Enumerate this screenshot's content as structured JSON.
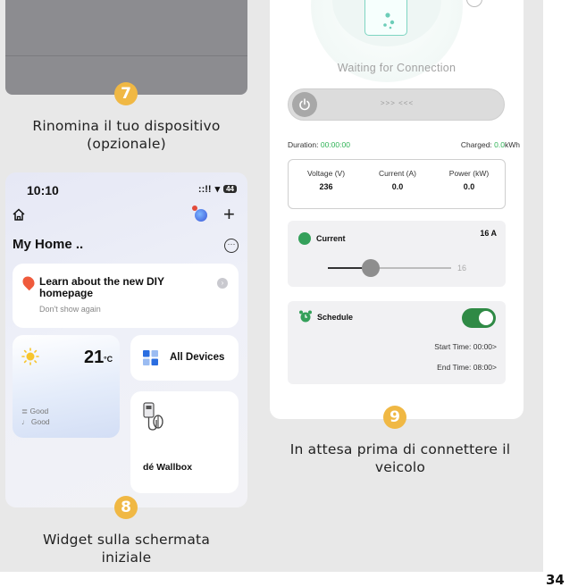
{
  "steps": {
    "step7": {
      "number": "7",
      "caption": "Rinomina il tuo dispositivo (opzionale)"
    },
    "step8": {
      "number": "8",
      "caption": "Widget sulla schermata iniziale"
    },
    "step9": {
      "number": "9",
      "caption": "In attesa prima di connettere il veicolo"
    }
  },
  "home_screen": {
    "status_time": "10:10",
    "status_signal": "::!! ",
    "status_wifi": "▾",
    "battery": "44",
    "title": "My Home ..",
    "learn_card": {
      "title": "Learn about the new DIY homepage",
      "dismiss": "Don't show again",
      "arrow": "›"
    },
    "weather": {
      "temperature": "21",
      "unit": "°C",
      "line1": "≣ Good",
      "line2": "♩ Good"
    },
    "all_devices_label": "All Devices",
    "wallbox_label": "dé Wallbox"
  },
  "charger_screen": {
    "status": "Waiting for Connection",
    "slide_hint": ">>> <<<",
    "duration_label": "Duration: ",
    "duration_value": "00:00:00",
    "charged_label": "Charged: ",
    "charged_value": "0.0",
    "charged_unit": "kWh",
    "metrics": [
      {
        "label": "Voltage (V)",
        "value": "236"
      },
      {
        "label": "Current (A)",
        "value": "0.0"
      },
      {
        "label": "Power (kW)",
        "value": "0.0"
      }
    ],
    "current": {
      "title": "Current",
      "value": "16 A",
      "slider_max": "16",
      "slider_level": 0.35
    },
    "schedule": {
      "title": "Schedule",
      "enabled": true,
      "start_time": "Start Time: 00:00>",
      "end_time": "End Time: 08:00>"
    }
  },
  "page_number": "34",
  "colors": {
    "badge": "#f0b844",
    "green": "#2fb356",
    "toggle": "#2f8a45"
  }
}
